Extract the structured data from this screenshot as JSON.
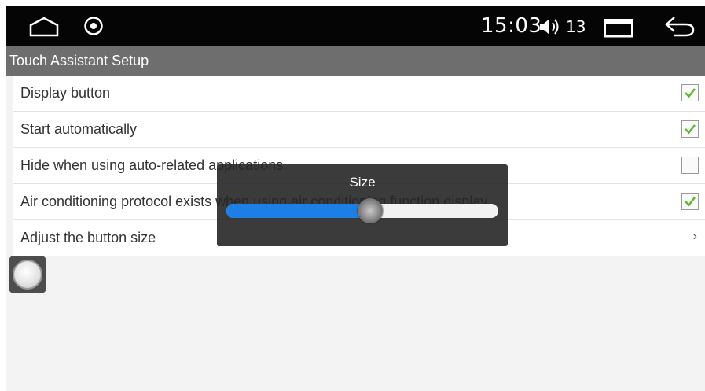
{
  "status_bar": {
    "time": "15:03",
    "volume": "13",
    "icons": [
      "home-icon",
      "disc-icon",
      "volume-icon",
      "recent-apps-icon",
      "back-icon"
    ]
  },
  "title": "Touch Assistant Setup",
  "settings": [
    {
      "label": "Display button",
      "checked": true
    },
    {
      "label": "Start automatically",
      "checked": true
    },
    {
      "label": "Hide when using auto-related applications.",
      "checked": false
    },
    {
      "label": "Air conditioning protocol exists when using air conditioning function display",
      "checked": true
    },
    {
      "label": "Adjust the button size",
      "chevron": "›"
    }
  ],
  "dialog": {
    "title": "Size",
    "slider_value_fraction": 0.53
  },
  "colors": {
    "accent": "#1d7fe6",
    "check": "#5cb82e",
    "titlebar": "#6e6e6e"
  }
}
